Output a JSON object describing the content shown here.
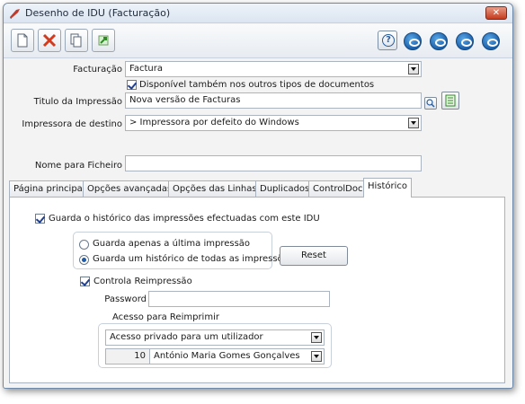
{
  "window": {
    "title": "Desenho de IDU (Facturação)",
    "close_label": "✕"
  },
  "form": {
    "facturacao_label": "Facturação",
    "facturacao_value": "Factura",
    "disponivel_label": "Disponível também nos outros tipos de documentos",
    "titulo_label": "Titulo da Impressão",
    "titulo_value": "Nova versão de Facturas",
    "impressora_label": "Impressora de destino",
    "impressora_value": "> Impressora por defeito do Windows",
    "nome_ficheiro_label": "Nome para Ficheiro",
    "nome_ficheiro_value": ""
  },
  "tabs": [
    {
      "label": "Página principal"
    },
    {
      "label": "Opções avançadas"
    },
    {
      "label": "Opções das Linhas"
    },
    {
      "label": "Duplicados"
    },
    {
      "label": "ControlDoc"
    },
    {
      "label": "Histórico"
    }
  ],
  "historico": {
    "guarda_historico_label": "Guarda o histórico das impressões efectuadas com este IDU",
    "radio_ultima_label": "Guarda apenas a última impressão",
    "radio_todas_label": "Guarda um histórico de todas as impressões",
    "reset_label": "Reset",
    "controla_label": "Controla Reimpressão",
    "password_label": "Password",
    "password_value": "",
    "acesso_label": "Acesso para Reimprimir",
    "acesso_value": "Acesso privado para um utilizador",
    "user_id": "10",
    "user_name": "António Maria Gomes Gonçalves"
  }
}
